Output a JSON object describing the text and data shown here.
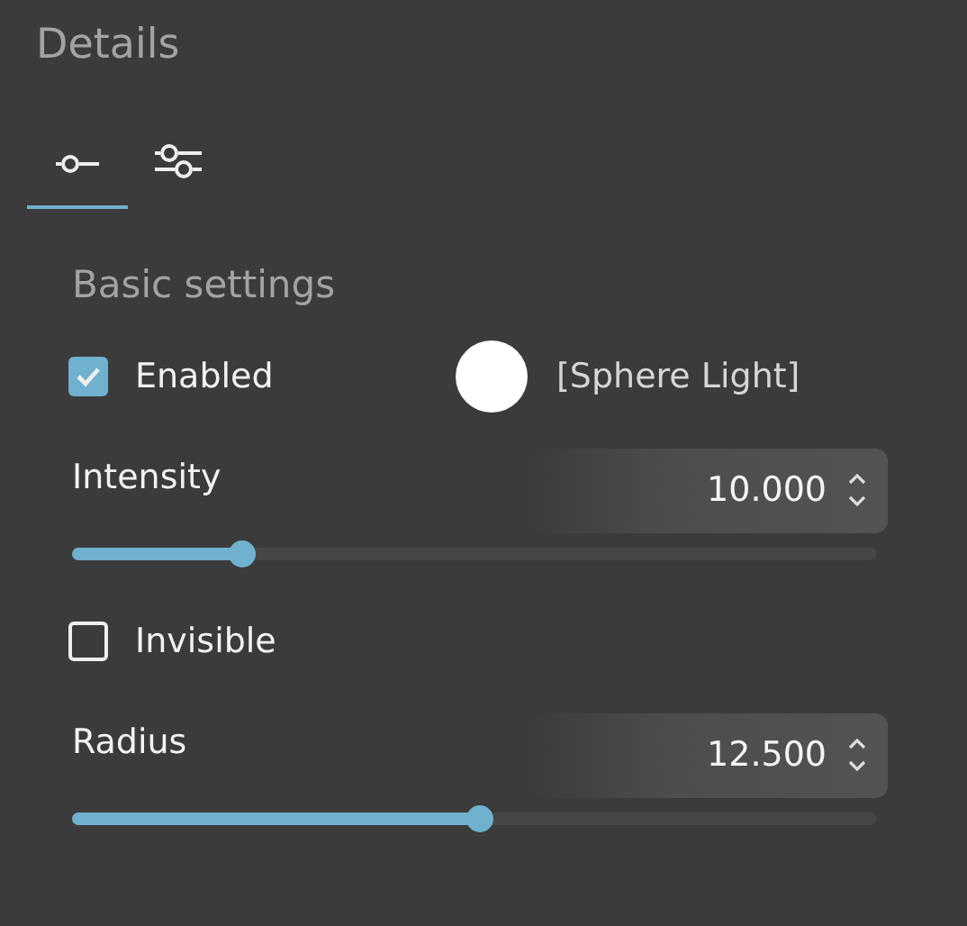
{
  "panel": {
    "title": "Details"
  },
  "tabs": [
    {
      "kind": "single",
      "selected": true
    },
    {
      "kind": "double",
      "selected": false
    }
  ],
  "section": {
    "title": "Basic settings"
  },
  "rows": [
    {
      "kind": "checkbox",
      "label": "Enabled",
      "checked": true,
      "object_label": "[Sphere Light]"
    },
    {
      "kind": "number",
      "label": "Intensity",
      "value": "10.000",
      "level": 0.21
    },
    {
      "kind": "checkbox",
      "label": "Invisible",
      "checked": false
    },
    {
      "kind": "number",
      "label": "Radius",
      "value": "12.500",
      "level": 0.505
    }
  ]
}
